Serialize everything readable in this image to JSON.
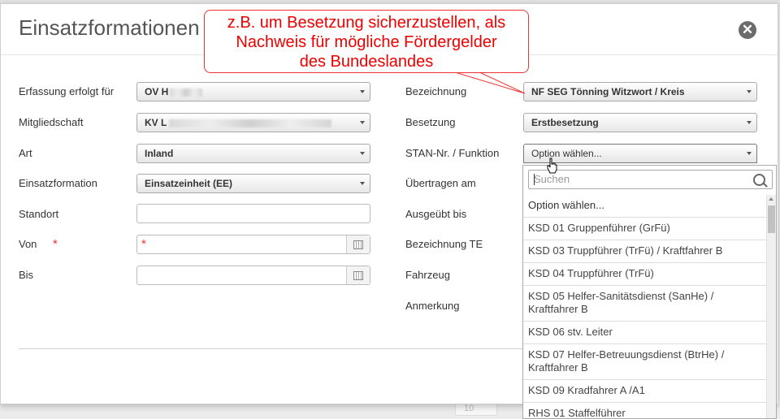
{
  "modal": {
    "title": "Einsatzformationen |",
    "close_label": "✕"
  },
  "left_form": {
    "erfassung": {
      "label": "Erfassung erfolgt für",
      "value": "OV H"
    },
    "mitgliedschaft": {
      "label": "Mitgliedschaft",
      "value": "KV L"
    },
    "art": {
      "label": "Art",
      "value": "Inland"
    },
    "einsatzformation": {
      "label": "Einsatzformation",
      "value": "Einsatzeinheit (EE)"
    },
    "standort": {
      "label": "Standort",
      "value": ""
    },
    "von": {
      "label": "Von",
      "required_marker": "*",
      "value": ""
    },
    "bis": {
      "label": "Bis",
      "value": ""
    }
  },
  "right_form": {
    "bezeichnung": {
      "label": "Bezeichnung",
      "value": "NF SEG Tönning Witzwort / Kreis"
    },
    "besetzung": {
      "label": "Besetzung",
      "value": "Erstbesetzung"
    },
    "stan": {
      "label": "STAN-Nr. / Funktion",
      "value": "Option wählen..."
    },
    "uebertragen": {
      "label": "Übertragen am"
    },
    "ausgeuebt": {
      "label": "Ausgeübt bis"
    },
    "bezeichnung_te": {
      "label": "Bezeichnung TE"
    },
    "fahrzeug": {
      "label": "Fahrzeug"
    },
    "anmerkung": {
      "label": "Anmerkung"
    }
  },
  "dropdown": {
    "search_placeholder": "Suchen",
    "options": [
      "Option wählen...",
      "KSD 01 Gruppenführer (GrFü)",
      "KSD 03 Truppführer (TrFü) / Kraftfahrer B",
      "KSD 04 Truppführer (TrFü)",
      "KSD 05 Helfer-Sanitätsdienst (SanHe) / Kraftfahrer B",
      "KSD 06 stv. Leiter",
      "KSD 07 Helfer-Betreuungsdienst (BtrHe) / Kraftfahrer B",
      "KSD 09 Kradfahrer A /A1",
      "RHS 01 Staffelführer"
    ]
  },
  "callout": {
    "line1": "z.B. um Besetzung sicherzustellen, als",
    "line2": "Nachweis für mögliche Fördergelder",
    "line3": "des Bundeslandes"
  },
  "background": {
    "page_size": "10"
  },
  "colors": {
    "required": "#e33333",
    "callout": "#ee0000"
  }
}
